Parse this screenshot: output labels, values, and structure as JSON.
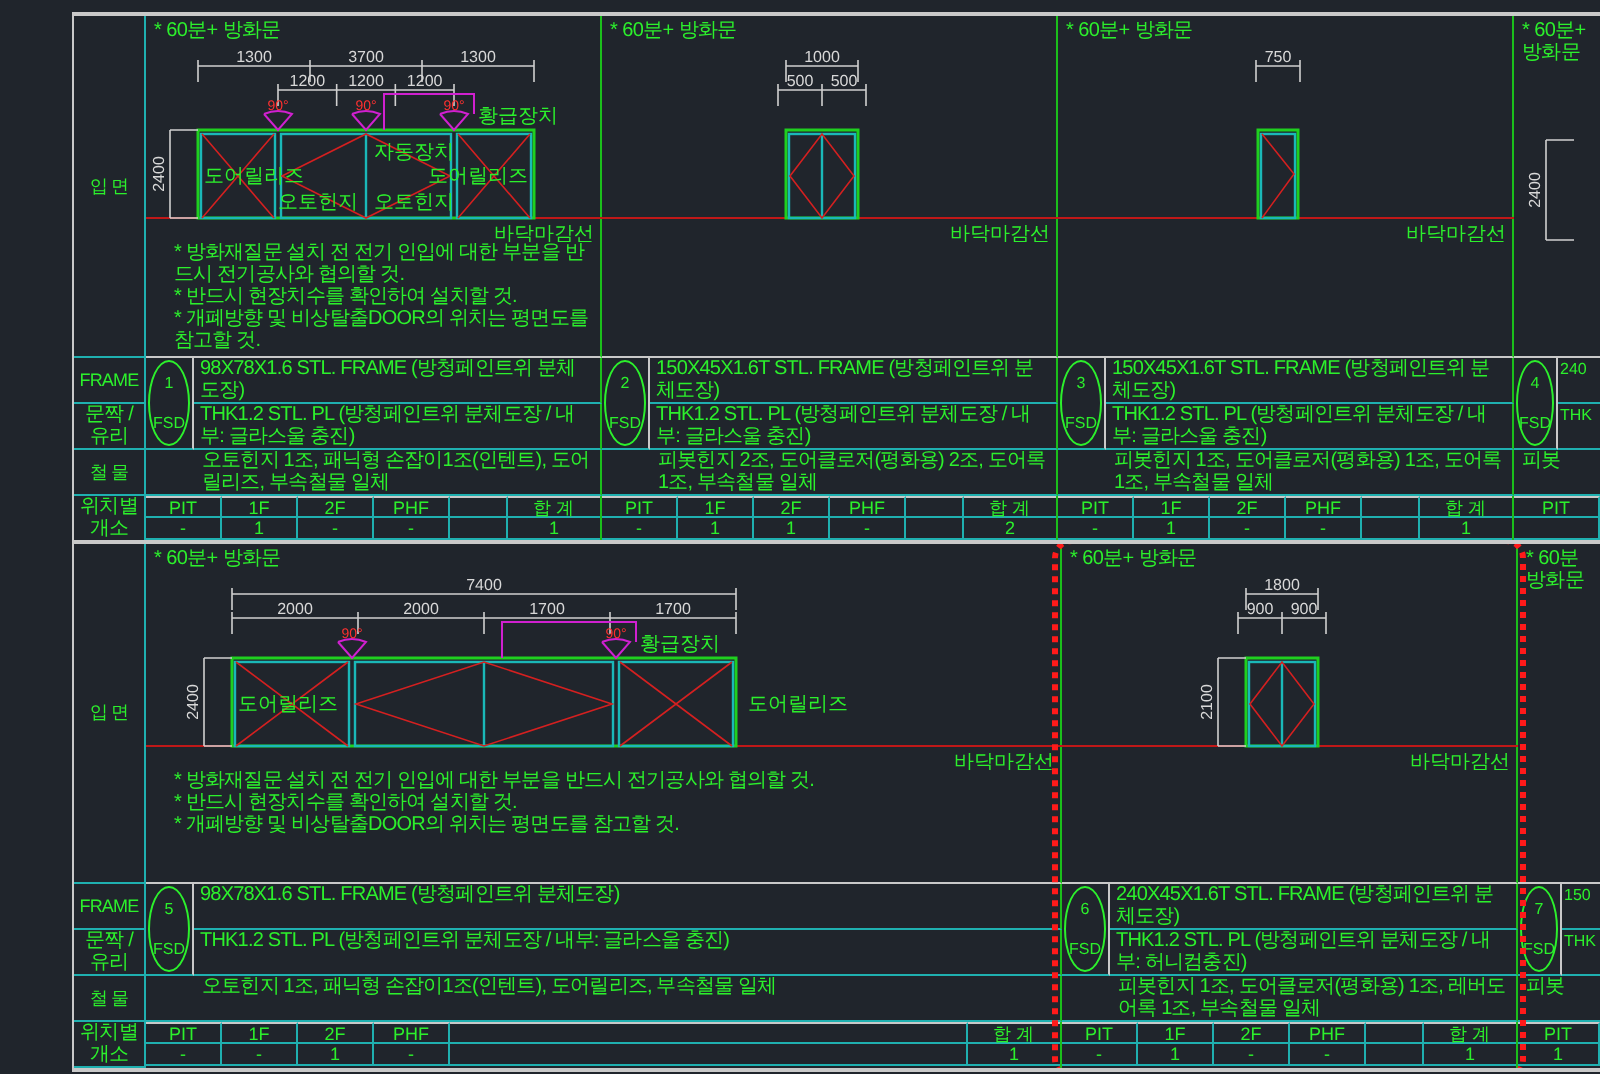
{
  "sections": [
    {
      "row_labels": {
        "elevation": "입 면",
        "frame": "FRAME",
        "leaf": "문짝 / 유리",
        "hardware": "철 물",
        "locations": "위치별개소"
      },
      "panels": [
        {
          "kind": "standard",
          "revised": false,
          "fire_rating": "* 60분+ 방화문",
          "dimension_rows": [
            {
              "kind": "overall",
              "values": [
                "1300",
                "3700",
                "1300"
              ]
            },
            {
              "kind": "inner",
              "values": [
                "1200",
                "1200",
                "1200"
              ]
            }
          ],
          "height_dims": [
            "2400"
          ],
          "leaves": [
            {
              "kind": "fixed"
            },
            {
              "kind": "double"
            },
            {
              "kind": "fixed"
            }
          ],
          "swing_angles": [
            "90°",
            "90°",
            "90°"
          ],
          "callouts": [
            {
              "text": "황급장치",
              "kind": "top"
            },
            {
              "text": "자동장치",
              "kind": "center"
            },
            {
              "text": "도어릴리즈",
              "kind": "left"
            },
            {
              "text": "도어릴리즈",
              "kind": "right"
            },
            {
              "text": "오토힌지",
              "kind": "bottom-left"
            },
            {
              "text": "오토힌지",
              "kind": "bottom-right"
            }
          ],
          "floor_label": "바닥마감선",
          "notes": [
            "* 방화재질문 설치 전 전기 인입에 대한 부분을 반드시 전기공사와 협의할 것.",
            "* 반드시 현장치수를 확인하여 설치할 것.",
            "* 개폐방향 및 비상탈출DOOR의 위치는 평면도를 참고할 것."
          ],
          "number": "1",
          "type_code": "FSD",
          "frame": "98X78X1.6 STL. FRAME (방청페인트위 분체도장)",
          "leaf": "THK1.2 STL. PL (방청페인트위 분체도장 / 내부: 글라스울 충진)",
          "hardware": "오토힌지 1조, 패닉형 손잡이1조(인텐트), 도어릴리즈, 부속철물 일체",
          "locations": [
            {
              "floor": "PIT",
              "count": "-"
            },
            {
              "floor": "1F",
              "count": "1"
            },
            {
              "floor": "2F",
              "count": "-"
            },
            {
              "floor": "PHF",
              "count": "-"
            }
          ],
          "total_label": "합 계",
          "total": "1"
        },
        {
          "kind": "standard",
          "revised": false,
          "fire_rating": "* 60분+ 방화문",
          "dimension_rows": [
            {
              "kind": "overall",
              "values": [
                "1000"
              ]
            },
            {
              "kind": "overall",
              "values": [
                "500",
                "500"
              ]
            }
          ],
          "leaves": [
            {
              "kind": "double"
            }
          ],
          "floor_label": "바닥마감선",
          "number": "2",
          "type_code": "FSD",
          "frame": "150X45X1.6T STL. FRAME (방청페인트위 분체도장)",
          "leaf": "THK1.2 STL. PL (방청페인트위 분체도장 / 내부: 글라스울 충진)",
          "hardware": "피봇힌지 2조, 도어클로저(평화용) 2조, 도어록 1조, 부속철물 일체",
          "locations": [
            {
              "floor": "PIT",
              "count": "-"
            },
            {
              "floor": "1F",
              "count": "1"
            },
            {
              "floor": "2F",
              "count": "1"
            },
            {
              "floor": "PHF",
              "count": "-"
            }
          ],
          "total_label": "합 계",
          "total": "2"
        },
        {
          "kind": "standard",
          "revised": false,
          "fire_rating": "* 60분+ 방화문",
          "dimension_rows": [
            {
              "kind": "overall",
              "values": [
                "750"
              ]
            }
          ],
          "leaves": [
            {
              "kind": "single"
            }
          ],
          "floor_label": "바닥마감선",
          "number": "3",
          "type_code": "FSD",
          "frame": "150X45X1.6T STL. FRAME (방청페인트위 분체도장)",
          "leaf": "THK1.2 STL. PL (방청페인트위 분체도장 / 내부: 글라스울 충진)",
          "hardware": "피봇힌지 1조, 도어클로저(평화용) 1조, 도어록 1조, 부속철물 일체",
          "locations": [
            {
              "floor": "PIT",
              "count": "-"
            },
            {
              "floor": "1F",
              "count": "1"
            },
            {
              "floor": "2F",
              "count": "-"
            },
            {
              "floor": "PHF",
              "count": "-"
            }
          ],
          "total_label": "합 계",
          "total": "1"
        },
        {
          "kind": "cut",
          "revised": false,
          "fire_rating": "* 60분+ 방화문",
          "height_dims": [
            "2400"
          ],
          "number": "4",
          "type_code": "FSD",
          "frame": "240",
          "leaf": "THK",
          "hardware": "피봇",
          "locations": [
            {
              "floor": "PIT"
            }
          ]
        }
      ]
    },
    {
      "row_labels": {
        "elevation": "입 면",
        "frame": "FRAME",
        "leaf": "문짝 / 유리",
        "hardware": "철 물",
        "locations": "위치별개소"
      },
      "panels": [
        {
          "kind": "wide",
          "revised": false,
          "fire_rating": "* 60분+ 방화문",
          "dimension_rows": [
            {
              "kind": "overall",
              "values": [
                "7400"
              ]
            },
            {
              "kind": "overall",
              "values": [
                "2000",
                "2000",
                "1700",
                "1700"
              ]
            }
          ],
          "height_dims": [
            "2400"
          ],
          "leaves": [
            {
              "kind": "fixed"
            },
            {
              "kind": "double"
            },
            {
              "kind": "fixed"
            }
          ],
          "swing_angles": [
            "90°",
            "90°"
          ],
          "callouts": [
            {
              "text": "황급장치",
              "kind": "top"
            },
            {
              "text": "도어릴리즈",
              "kind": "left"
            },
            {
              "text": "도어릴리즈",
              "kind": "outer-right"
            }
          ],
          "floor_label": "바닥마감선",
          "notes": [
            "* 방화재질문 설치 전 전기 인입에 대한 부분을 반드시 전기공사와 협의할 것.",
            "* 반드시 현장치수를 확인하여 설치할 것.",
            "* 개폐방향 및 비상탈출DOOR의 위치는 평면도를 참고할 것."
          ],
          "number": "5",
          "type_code": "FSD",
          "frame": "98X78X1.6 STL. FRAME (방청페인트위 분체도장)",
          "leaf": "THK1.2 STL. PL (방청페인트위 분체도장 / 내부: 글라스울 충진)",
          "hardware": "오토힌지 1조, 패닉형 손잡이1조(인텐트), 도어릴리즈, 부속철물 일체",
          "locations": [
            {
              "floor": "PIT",
              "count": "-"
            },
            {
              "floor": "1F",
              "count": "-"
            },
            {
              "floor": "2F",
              "count": "1"
            },
            {
              "floor": "PHF",
              "count": "-"
            }
          ],
          "total_label": "합 계",
          "total": "1"
        },
        {
          "kind": "standard",
          "revised": true,
          "fire_rating": "* 60분+ 방화문",
          "dimension_rows": [
            {
              "kind": "overall",
              "values": [
                "1800"
              ]
            },
            {
              "kind": "overall",
              "values": [
                "900",
                "900"
              ]
            }
          ],
          "height_dims": [
            "2100"
          ],
          "leaves": [
            {
              "kind": "double"
            }
          ],
          "floor_label": "바닥마감선",
          "number": "6",
          "type_code": "FSD",
          "frame": "240X45X1.6T STL. FRAME (방청페인트위 분체도장)",
          "leaf": "THK1.2 STL. PL (방청페인트위 분체도장 / 내부: 허니컴충진)",
          "hardware": "피봇힌지 1조, 도어클로저(평화용) 1조, 레버도어록 1조, 부속철물 일체",
          "locations": [
            {
              "floor": "PIT",
              "count": "-"
            },
            {
              "floor": "1F",
              "count": "1"
            },
            {
              "floor": "2F",
              "count": "-"
            },
            {
              "floor": "PHF",
              "count": "-"
            }
          ],
          "total_label": "합 계",
          "total": "1"
        },
        {
          "kind": "cut",
          "revised": false,
          "fire_rating": "* 60분 방화문",
          "number": "7",
          "type_code": "FSD",
          "frame": "150",
          "leaf": "THK",
          "hardware": "피봇",
          "locations": [
            {
              "floor": "PIT",
              "count": "1"
            }
          ]
        }
      ]
    }
  ]
}
